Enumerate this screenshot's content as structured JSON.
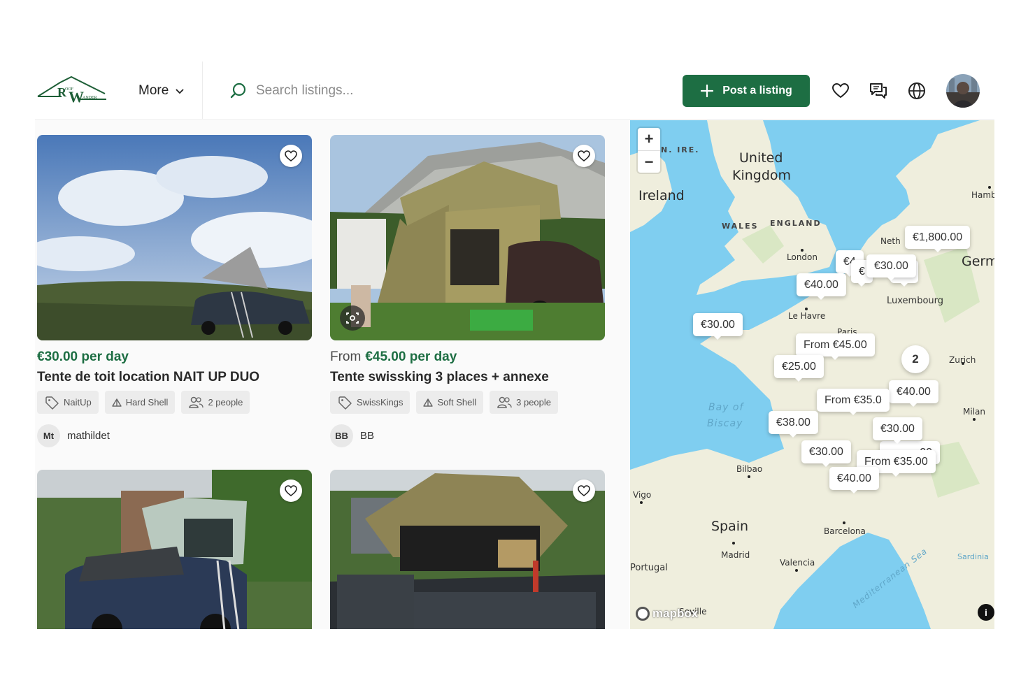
{
  "header": {
    "logo_alt": "RW",
    "more_label": "More",
    "search_placeholder": "Search listings...",
    "post_listing_label": "Post a listing"
  },
  "listings": [
    {
      "price_prefix": "",
      "price": "€30.00 per day",
      "title": "Tente de toit location NAIT UP DUO",
      "tags": [
        "NaitUp",
        "Hard Shell",
        "2 people"
      ],
      "owner_initials": "Mt",
      "owner_name": "mathildet"
    },
    {
      "price_prefix": "From",
      "price": "€45.00 per day",
      "title": "Tente swissking 3 places + annexe",
      "tags": [
        "SwissKings",
        "Soft Shell",
        "3 people"
      ],
      "owner_initials": "BB",
      "owner_name": "BB"
    },
    {
      "title": "",
      "price": ""
    },
    {
      "title": "",
      "price": ""
    }
  ],
  "map": {
    "countries": [
      "United",
      "Kingdom",
      "Ireland",
      "Spain",
      "Germ",
      "N. IRE.",
      "Portugal"
    ],
    "regions": [
      "WALES",
      "ENGLAND"
    ],
    "cities": [
      "London",
      "Le Havre",
      "Luxembourg",
      "Paris",
      "Zurich",
      "Milan",
      "Bilbao",
      "Vigo",
      "Madrid",
      "Barcelona",
      "Valencia",
      "Sardinia",
      "Hamb",
      "Seville",
      "Neth"
    ],
    "seas": [
      "Bay of",
      "Biscay",
      "Mediterranean Sea"
    ],
    "pins": [
      "€1,800.00",
      "€30.00",
      "€40.00",
      "€30.00",
      "From €45.00",
      "€25.00",
      "€40.00",
      "From €35.0",
      "€38.00",
      "€30.00",
      "€30.00",
      "From €35.00",
      "€40.00",
      "€4",
      "€",
      "00"
    ],
    "cluster": "2",
    "attribution": "mapbox"
  },
  "colors": {
    "brand_green": "#1d6e43",
    "sea": "#7fcef0",
    "land": "#efeedd"
  }
}
